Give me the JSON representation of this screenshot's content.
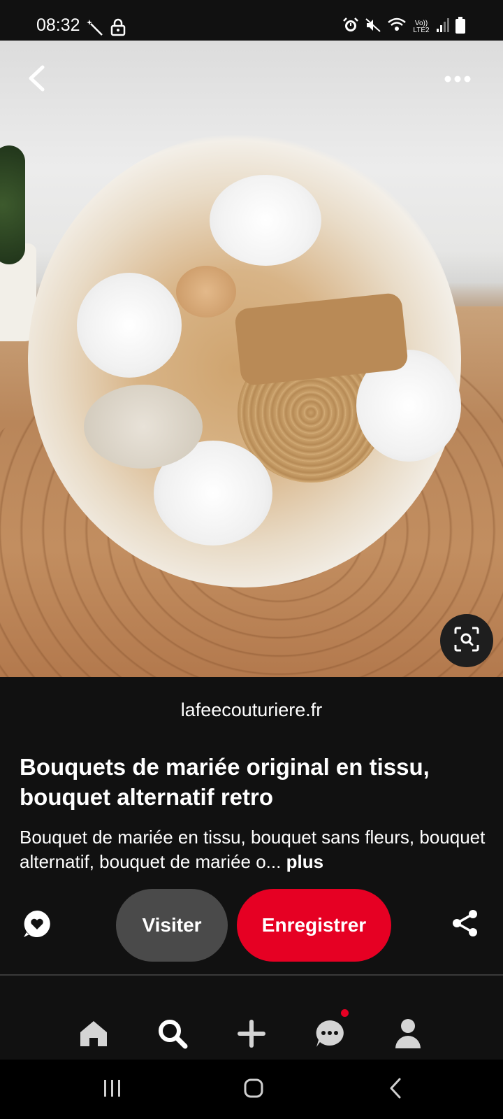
{
  "status_bar": {
    "time": "08:32",
    "left_icons": [
      "magic-wand-icon",
      "lock-icon"
    ],
    "right_icons": [
      "alarm-icon",
      "mute-icon",
      "wifi-icon",
      "volte-icon",
      "signal-icon",
      "battery-icon"
    ],
    "volte_label": "Vo)) LTE2"
  },
  "photo": {
    "description_icon_names": [
      "back-arrow-icon",
      "more-options-icon",
      "visual-search-icon"
    ]
  },
  "pin": {
    "source_domain": "lafeecouturiere.fr",
    "title": "Bouquets de mariée original en tissu, bouquet alternatif retro",
    "description": "Bouquet de mariée en tissu, bouquet sans fleurs, bouquet alternatif, bouquet de mariée o...",
    "more_label": "plus"
  },
  "actions": {
    "visit_label": "Visiter",
    "save_label": "Enregistrer"
  },
  "bottom_nav": {
    "items": [
      "home-icon",
      "search-icon",
      "create-icon",
      "messages-icon",
      "profile-icon"
    ],
    "active": "search-icon",
    "notification_on": "messages-icon"
  },
  "system_nav": [
    "recents-icon",
    "home-icon",
    "back-icon"
  ],
  "colors": {
    "background": "#111111",
    "save_button": "#e60023",
    "visit_button": "#4a4a4a",
    "notification_dot": "#e60023"
  }
}
